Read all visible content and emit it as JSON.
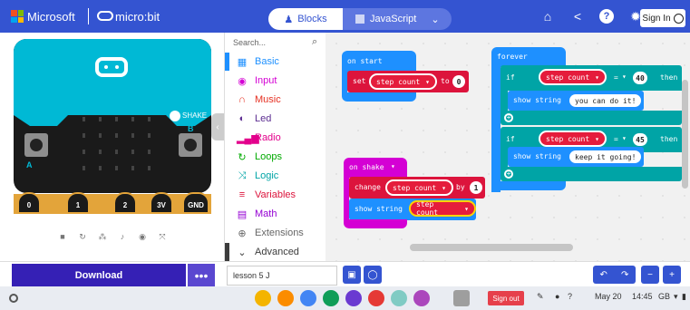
{
  "header": {
    "microsoft_label": "Microsoft",
    "microbit_label": "micro:bit",
    "tabs": [
      {
        "label": "Blocks",
        "active": true,
        "icon": "puzzle-icon"
      },
      {
        "label": "JavaScript",
        "active": false,
        "icon": "js-icon"
      }
    ],
    "icons": [
      "home-icon",
      "share-icon",
      "help-icon",
      "settings-icon"
    ],
    "signin_label": "Sign In",
    "colors": {
      "bar": "#3454d1",
      "accent": "#5d76e0"
    }
  },
  "simulator": {
    "shake_label": "SHAKE",
    "button_a": "A",
    "button_b": "B",
    "pins": [
      "0",
      "1",
      "2",
      "3V",
      "GND"
    ],
    "controls": [
      "stop-icon",
      "restart-icon",
      "slowmo-icon",
      "mute-icon",
      "screenshot-icon",
      "fullscreen-icon"
    ],
    "colors": {
      "board_blue": "#00b9d5",
      "pin_gold": "#e3a43a"
    }
  },
  "toolbox": {
    "search_placeholder": "Search...",
    "categories": [
      {
        "label": "Basic",
        "color": "#1e90ff",
        "icon": "grid-icon"
      },
      {
        "label": "Input",
        "color": "#d400d4",
        "icon": "target-icon"
      },
      {
        "label": "Music",
        "color": "#e63022",
        "icon": "headphones-icon"
      },
      {
        "label": "Led",
        "color": "#5c2d91",
        "icon": "toggle-icon"
      },
      {
        "label": "Radio",
        "color": "#e3008c",
        "icon": "signal-icon"
      },
      {
        "label": "Loops",
        "color": "#00aa00",
        "icon": "refresh-icon"
      },
      {
        "label": "Logic",
        "color": "#00a4a6",
        "icon": "shuffle-icon"
      },
      {
        "label": "Variables",
        "color": "#dc143c",
        "icon": "lines-icon"
      },
      {
        "label": "Math",
        "color": "#9400d3",
        "icon": "calculator-icon"
      },
      {
        "label": "Extensions",
        "color": "#666666",
        "icon": "plus-circle-icon"
      },
      {
        "label": "Advanced",
        "color": "#3c3c3c",
        "icon": "chevron-down-icon"
      }
    ]
  },
  "workspace": {
    "on_start": {
      "label": "on start",
      "set_kw": "set",
      "variable": "step count",
      "to_kw": "to",
      "value": "0"
    },
    "on_shake": {
      "label": "on shake",
      "change_kw": "change",
      "variable": "step count",
      "by_kw": "by",
      "value": "1",
      "show_kw": "show string",
      "show_var": "step count"
    },
    "forever": {
      "label": "forever",
      "if1": {
        "if_kw": "if",
        "variable": "step count",
        "op": "=",
        "value": "40",
        "then_kw": "then",
        "show_kw": "show string",
        "text": "you can do it!"
      },
      "if2": {
        "if_kw": "if",
        "variable": "step count",
        "op": "=",
        "value": "45",
        "then_kw": "then",
        "show_kw": "show string",
        "text": "keep it going!"
      }
    },
    "colors": {
      "events": "#1e90ff",
      "variables": "#dc143c",
      "basic": "#1e90ff",
      "logic": "#00a4a6",
      "input": "#d400d4"
    }
  },
  "editor_bar": {
    "download_label": "Download",
    "more_label": "•••",
    "project_name": "lesson 5 J",
    "icons": [
      "save-icon",
      "github-icon",
      "undo-icon",
      "redo-icon",
      "zoom-out-icon",
      "zoom-in-icon"
    ]
  },
  "taskbar": {
    "signout_label": "Sign out",
    "date": "May 20",
    "time": "14:45",
    "region": "GB"
  }
}
